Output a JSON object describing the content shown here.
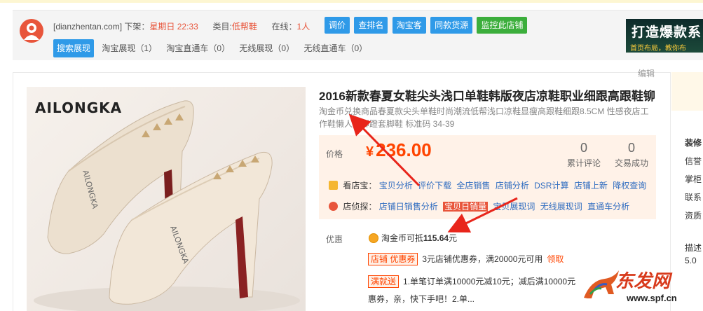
{
  "toolbar": {
    "site": "[dianzhentan.com]",
    "offshelf_label": "下架：",
    "offshelf_value": "星期日 22:33",
    "category_label": "类目:",
    "category_value": "低帮鞋",
    "online_label": "在线：",
    "online_value": "1人",
    "buttons": [
      "调价",
      "查排名",
      "淘宝客",
      "同款货源",
      "监控此店铺"
    ],
    "search_display": "搜索展现",
    "stats": [
      "淘宝展现（1）",
      "淘宝直通车（0）",
      "无线展现（0）",
      "无线直通车（0）"
    ]
  },
  "banner": {
    "line1": "打造爆款系",
    "line2": "首页布局，教你布"
  },
  "edit_label": "编辑",
  "product": {
    "brand": "AILONGKA",
    "shoe_brand": "AILONGKA",
    "title": "2016新款春夏女鞋尖头浅口单鞋韩版夜店凉鞋职业细跟高跟鞋铆",
    "subtitle": "淘金币兑换商品春夏款尖头单鞋时尚潮流低帮浅口凉鞋显瘦高跟鞋细跟8.5CM 性感夜店工作鞋懒人一脚蹬套脚鞋 标准码 34-39"
  },
  "price": {
    "label": "价格",
    "currency": "¥",
    "value": "236.00",
    "reviews_count": "0",
    "reviews_label": "累计评论",
    "sales_count": "0",
    "sales_label": "交易成功"
  },
  "tools": {
    "shop_lead": "看店宝：",
    "shop_links": [
      "宝贝分析",
      "评价下载",
      "全店销售",
      "店铺分析",
      "DSR计算",
      "店铺上新",
      "降权查询"
    ],
    "detect_lead": "店侦探：",
    "detect_links": [
      "店铺日销售分析",
      "宝贝日销量",
      "宝贝展现词",
      "无线展现词",
      "直通车分析"
    ]
  },
  "promo": {
    "label": "优惠",
    "coin_prefix": "淘金币可抵",
    "coin_value": "115.64",
    "coin_suffix": "元",
    "coupon_tag": "店铺 优惠券",
    "coupon_text": "3元店铺优惠券，满20000元可用",
    "coupon_action": "领取",
    "full_tag": "满就送",
    "full_text": "1.单笔订单满10000元减10元；减后满10000元",
    "full_text2": "惠券，亲，快下手吧！2.单..."
  },
  "rail": {
    "head": "装修",
    "items": [
      "信誉",
      "掌柜",
      "联系",
      "资质"
    ],
    "desc_label": "描述",
    "desc_score": "5.0"
  },
  "watermark": {
    "text": "东发网",
    "url": "www.spf.cn"
  },
  "colors": {
    "accent_blue": "#2f9ae8",
    "accent_green": "#3cae3c",
    "price_red": "#ff4400",
    "brand_red": "#e8553b"
  }
}
